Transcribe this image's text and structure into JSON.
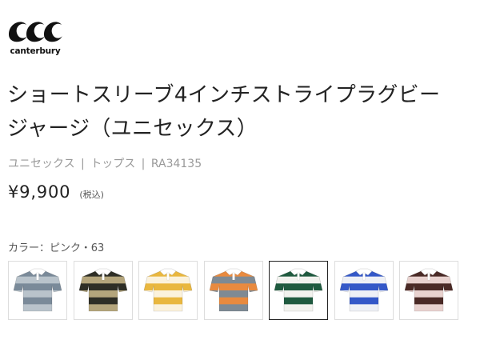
{
  "brand": {
    "name": "canterbury",
    "logo_icon": "ccc-logo-icon"
  },
  "product": {
    "title_line1": "ショートスリーブ4インチストライプラグビー",
    "title_line2": "ジャージ（ユニセックス）",
    "category": "ユニセックス",
    "type": "トップス",
    "code": "RA34135",
    "separator": "|",
    "price": "¥9,900",
    "tax_note": "(税込)"
  },
  "color_selector": {
    "label": "カラー：ピンク・63",
    "options": [
      {
        "id": "grey",
        "stripe_a": "#7a8a99",
        "stripe_b": "#b9c3cb",
        "collar": "#ffffff",
        "selected": false
      },
      {
        "id": "khaki-black",
        "stripe_a": "#2e2e26",
        "stripe_b": "#b4a57c",
        "collar": "#ffffff",
        "selected": false
      },
      {
        "id": "yellow",
        "stripe_a": "#e9b73f",
        "stripe_b": "#fbf2dc",
        "collar": "#ffffff",
        "selected": false
      },
      {
        "id": "orange-grey",
        "stripe_a": "#e88a3f",
        "stripe_b": "#7e8a94",
        "collar": "#ffffff",
        "selected": false
      },
      {
        "id": "green",
        "stripe_a": "#1f5a3f",
        "stripe_b": "#f2f2ee",
        "collar": "#ffffff",
        "selected": true
      },
      {
        "id": "blue",
        "stripe_a": "#3458c8",
        "stripe_b": "#eef0f6",
        "collar": "#ffffff",
        "selected": false
      },
      {
        "id": "pink-brown",
        "stripe_a": "#4a2a26",
        "stripe_b": "#e8d2cf",
        "collar": "#ffffff",
        "selected": false
      }
    ]
  }
}
